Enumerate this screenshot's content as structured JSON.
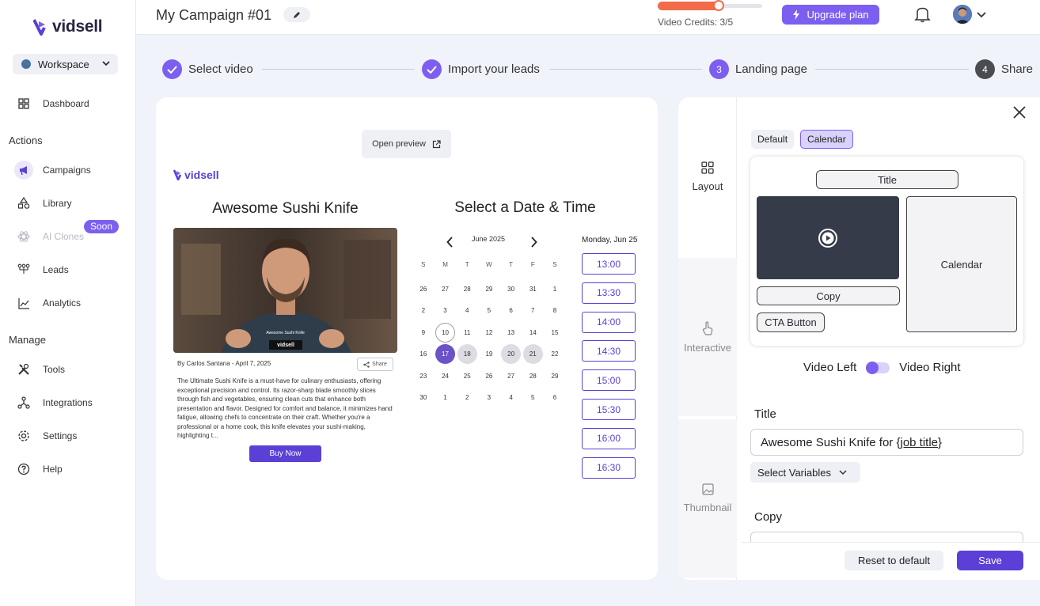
{
  "brand": {
    "name": "vidsell",
    "accent": "#7c5ff0",
    "accent_dark": "#5b3fd6"
  },
  "sidebar": {
    "workspace": "Workspace",
    "dashboard": "Dashboard",
    "actions_label": "Actions",
    "actions": [
      {
        "label": "Campaigns",
        "icon": "megaphone-icon",
        "active": true
      },
      {
        "label": "Library",
        "icon": "shapes-icon"
      },
      {
        "label": "AI Clones",
        "icon": "atom-icon",
        "disabled": true,
        "badge": "Soon"
      },
      {
        "label": "Leads",
        "icon": "leads-icon"
      },
      {
        "label": "Analytics",
        "icon": "chart-icon"
      }
    ],
    "manage_label": "Manage",
    "manage": [
      {
        "label": "Tools",
        "icon": "tools-icon"
      },
      {
        "label": "Integrations",
        "icon": "integrations-icon"
      },
      {
        "label": "Settings",
        "icon": "gear-icon"
      },
      {
        "label": "Help",
        "icon": "help-icon"
      }
    ]
  },
  "topbar": {
    "campaign_title": "My Campaign #01",
    "credits_text": "Video Credits: 3/5",
    "credits_progress": 0.6,
    "upgrade_label": "Upgrade plan"
  },
  "steps": [
    {
      "label": "Select video",
      "state": "done"
    },
    {
      "label": "Import your leads",
      "state": "done"
    },
    {
      "label": "Landing page",
      "number": "3",
      "state": "current"
    },
    {
      "label": "Share",
      "number": "4",
      "state": "todo"
    }
  ],
  "preview": {
    "open_preview": "Open preview",
    "logo": "vidsell",
    "product_title": "Awesome Sushi Knife",
    "video_caption": "Awesome Sushi Knife",
    "video_logo": "vidsell",
    "byline": "By Carlos Santana - April 7, 2025",
    "share": "Share",
    "description": "The Ultimate Sushi Knife is a must-have for culinary enthusiasts, offering exceptional precision and control. Its razor-sharp blade smoothly slices through fish and vegetables, ensuring clean cuts that enhance both presentation and flavor. Designed for comfort and balance, it minimizes hand fatigue, allowing chefs to concentrate on their craft. Whether you're a professional or a home cook, this knife elevates your sushi-making, highlighting t...",
    "buy_now": "Buy Now",
    "calendar_heading": "Select a Date & Time",
    "month": "June 2025",
    "weekdays": [
      "S",
      "M",
      "T",
      "W",
      "T",
      "F",
      "S"
    ],
    "days": [
      [
        "26",
        "27",
        "28",
        "29",
        "30",
        "31",
        "1"
      ],
      [
        "2",
        "3",
        "4",
        "5",
        "6",
        "7",
        "8"
      ],
      [
        "9",
        "10",
        "11",
        "12",
        "13",
        "14",
        "15"
      ],
      [
        "16",
        "17",
        "18",
        "19",
        "20",
        "21",
        "22"
      ],
      [
        "23",
        "24",
        "25",
        "26",
        "27",
        "28",
        "29"
      ],
      [
        "30",
        "1",
        "2",
        "3",
        "4",
        "5",
        "6"
      ]
    ],
    "today": "10",
    "selected": "17",
    "available": [
      "18",
      "20",
      "21"
    ],
    "slot_date": "Monday, Jun 25",
    "slots": [
      "13:00",
      "13:30",
      "14:00",
      "14:30",
      "15:00",
      "15:30",
      "16:00",
      "16:30"
    ]
  },
  "editor": {
    "tabs": [
      {
        "label": "Layout",
        "icon": "layout-icon",
        "active": true
      },
      {
        "label": "Interactive",
        "icon": "pointer-icon"
      },
      {
        "label": "Thumbnail",
        "icon": "image-icon"
      }
    ],
    "layout_modes": [
      "Default",
      "Calendar"
    ],
    "active_mode": "Calendar",
    "layout_preview": {
      "title": "Title",
      "copy": "Copy",
      "cta": "CTA Button",
      "calendar": "Calendar"
    },
    "video_left": "Video Left",
    "video_right": "Video Right",
    "title_label": "Title",
    "title_value_prefix": "Awesome Sushi Knife for {",
    "title_value_var": "job title",
    "title_value_suffix": "}",
    "select_variables": "Select Variables",
    "copy_label": "Copy",
    "reset": "Reset to default",
    "save": "Save"
  }
}
